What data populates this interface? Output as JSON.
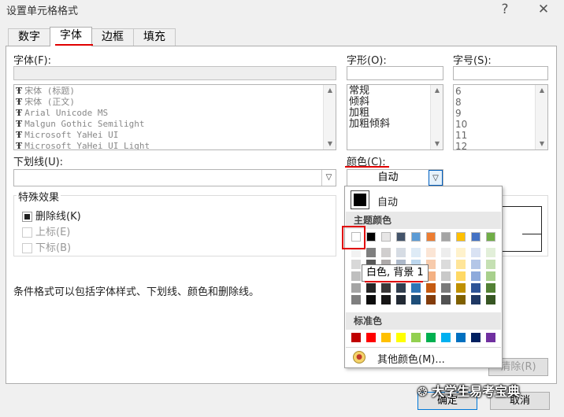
{
  "window": {
    "title": "设置单元格格式",
    "help_icon": "?",
    "close_icon": "✕"
  },
  "tabs": [
    "数字",
    "字体",
    "边框",
    "填充"
  ],
  "font": {
    "label": "字体(F):",
    "value": "",
    "items": [
      "宋体 (标题)",
      "宋体 (正文)",
      "Arial Unicode MS",
      "Malgun Gothic Semilight",
      "Microsoft YaHei UI",
      "Microsoft YaHei UI Light"
    ]
  },
  "style": {
    "label": "字形(O):",
    "value": "",
    "items": [
      "常规",
      "倾斜",
      "加粗",
      "加粗倾斜"
    ]
  },
  "size": {
    "label": "字号(S):",
    "value": "",
    "items": [
      "6",
      "8",
      "9",
      "10",
      "11",
      "12"
    ]
  },
  "underline": {
    "label": "下划线(U):",
    "value": ""
  },
  "color": {
    "label": "颜色(C):",
    "value": "自动"
  },
  "effects": {
    "label": "特殊效果",
    "items": [
      {
        "label": "删除线(K)",
        "checked": true,
        "enabled": true
      },
      {
        "label": "上标(E)",
        "checked": false,
        "enabled": false
      },
      {
        "label": "下标(B)",
        "checked": false,
        "enabled": false
      }
    ]
  },
  "note": "条件格式可以包括字体样式、下划线、颜色和删除线。",
  "color_popup": {
    "auto_label": "自动",
    "theme_label": "主题颜色",
    "standard_label": "标准色",
    "more_label": "其他颜色(M)...",
    "theme_row": [
      "#FFFFFF",
      "#000000",
      "#E7E6E6",
      "#44546A",
      "#5B9BD5",
      "#ED7D31",
      "#A5A5A5",
      "#FFC000",
      "#4472C4",
      "#70AD47"
    ],
    "theme_shades": [
      [
        "#F2F2F2",
        "#7F7F7F",
        "#D0CECE",
        "#D6DCE4",
        "#DEEBF6",
        "#FBE5D5",
        "#EDEDED",
        "#FFF2CC",
        "#D9E2F3",
        "#E2EFD9"
      ],
      [
        "#D8D8D8",
        "#595959",
        "#AEAAAA",
        "#ADB9CA",
        "#BDD7EE",
        "#F7CBAC",
        "#DBDBDB",
        "#FFE599",
        "#B4C6E7",
        "#C5E0B3"
      ],
      [
        "#BFBFBF",
        "#3F3F3F",
        "#757070",
        "#8496B0",
        "#9CC3E5",
        "#F4B183",
        "#C9C9C9",
        "#FFD965",
        "#8EAADB",
        "#A8D08D"
      ],
      [
        "#A5A5A5",
        "#262626",
        "#3A3838",
        "#323F4F",
        "#2E75B5",
        "#C55A11",
        "#7B7B7B",
        "#BF9000",
        "#2F5496",
        "#538135"
      ],
      [
        "#7F7F7F",
        "#0C0C0C",
        "#171616",
        "#222A35",
        "#1E4E79",
        "#833C0B",
        "#525252",
        "#7F6000",
        "#1F3864",
        "#375623"
      ]
    ],
    "standard_row": [
      "#C00000",
      "#FF0000",
      "#FFC000",
      "#FFFF00",
      "#92D050",
      "#00B050",
      "#00B0F0",
      "#0070C0",
      "#002060",
      "#7030A0"
    ]
  },
  "tooltip": "白色, 背景 1",
  "buttons": {
    "clear": "清除(R)",
    "ok": "确定",
    "cancel": "取消"
  },
  "watermark": "大学生易考宝典",
  "colors": {
    "highlight": "#e00000",
    "dropdown_blue": "#0060c0"
  }
}
